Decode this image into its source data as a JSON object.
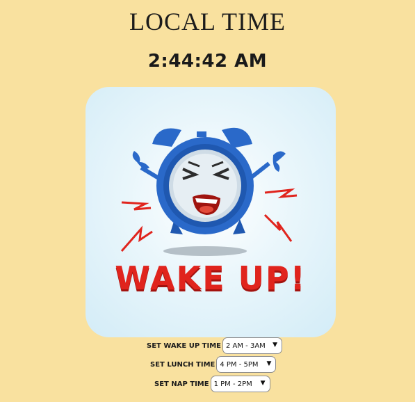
{
  "page": {
    "title": "LOCAL TIME",
    "time": "2:44:42 AM"
  },
  "image": {
    "text": "WAKE UP!",
    "icon": "angry-alarm-clock"
  },
  "settings": [
    {
      "label": "SET WAKE UP TIME",
      "value": "2 AM - 3AM"
    },
    {
      "label": "SET LUNCH TIME",
      "value": "4 PM - 5PM"
    },
    {
      "label": "SET NAP TIME",
      "value": "1 PM - 2PM"
    }
  ],
  "colors": {
    "background": "#f9e19f",
    "clock_blue": "#2a69c9",
    "wake_red": "#e0241d"
  }
}
